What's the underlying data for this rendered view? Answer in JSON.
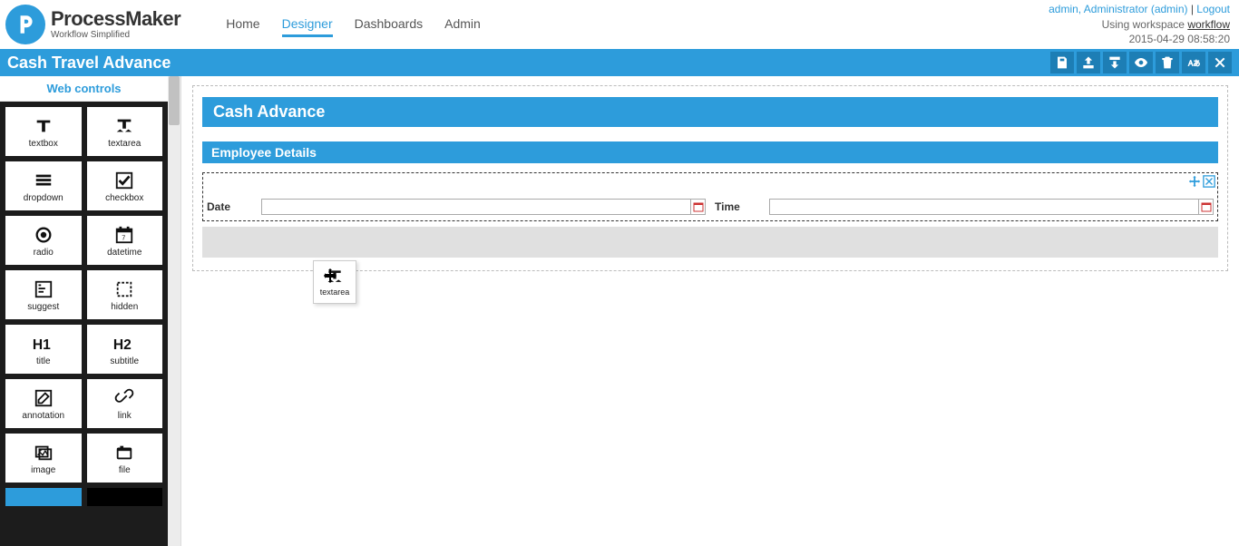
{
  "brand": {
    "name": "ProcessMaker",
    "tagline": "Workflow Simplified"
  },
  "nav": [
    "Home",
    "Designer",
    "Dashboards",
    "Admin"
  ],
  "nav_active_index": 1,
  "user_line": {
    "user": "admin, Administrator (admin)",
    "sep": " | ",
    "logout": "Logout"
  },
  "workspace_line": {
    "prefix": "Using workspace ",
    "name": "workflow"
  },
  "timestamp": "2015-04-29 08:58:20",
  "page_title": "Cash Travel Advance",
  "toolbar_icons": [
    "save-icon",
    "import-icon",
    "export-icon",
    "preview-icon",
    "delete-icon",
    "language-icon",
    "close-icon"
  ],
  "sidebar_header": "Web controls",
  "controls": [
    "textbox",
    "textarea",
    "dropdown",
    "checkbox",
    "radio",
    "datetime",
    "suggest",
    "hidden",
    "title",
    "subtitle",
    "annotation",
    "link",
    "image",
    "file"
  ],
  "form": {
    "section_title": "Cash Advance",
    "section_subtitle": "Employee Details",
    "fields": [
      {
        "label": "Date",
        "value": ""
      },
      {
        "label": "Time",
        "value": ""
      }
    ]
  },
  "drag_ghost_label": "textarea"
}
